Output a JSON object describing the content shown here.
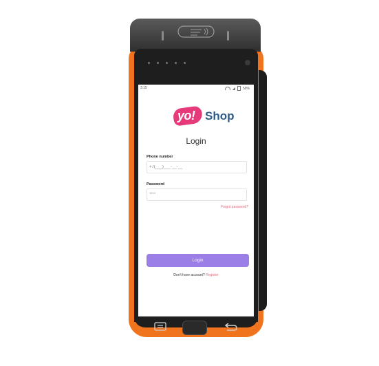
{
  "status_bar": {
    "time": "3:15",
    "battery": "59%"
  },
  "logo": {
    "yo": "yo!",
    "shop": "Shop"
  },
  "login_form": {
    "title": "Login",
    "phone_label": "Phone number",
    "phone_placeholder": "+7(___)___-__-__",
    "password_label": "Password",
    "password_value": "****",
    "forgot_link": "Forgot password?",
    "login_button": "Login",
    "no_account_text": "Don't have account?",
    "register_link": "Register"
  },
  "colors": {
    "device_shell": "#f0731d",
    "login_button": "#9b7fe6",
    "logo_pink": "#e73a7a",
    "logo_blue": "#2e5b8b",
    "link": "#e8677a"
  },
  "icons": {
    "printer_nfc": "contactless-icon",
    "nav_menu": "menu-icon",
    "nav_home": "home-button",
    "nav_back": "back-icon"
  }
}
